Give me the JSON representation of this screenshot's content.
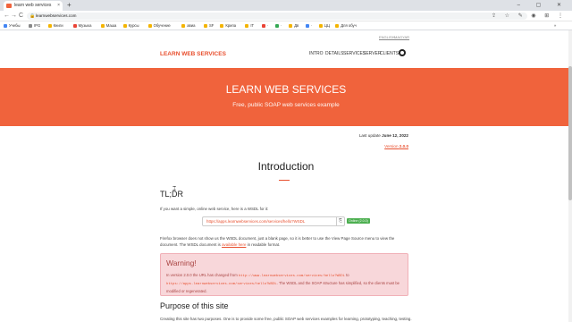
{
  "browser": {
    "tab_title": "learn web services",
    "tab_close": "×",
    "new_tab": "+",
    "window_controls": "– ▢ ✕",
    "url": "learnwebservices.com",
    "nav_back": "←",
    "nav_forward": "→",
    "nav_reload": "C",
    "lock_icon": "🔒",
    "toolbar_icons": "⇪ ☆ ✎ ◉ ⊞ ⋮",
    "bookmarks": [
      {
        "label": "Учебы",
        "color": "#4285f4"
      },
      {
        "label": "IPG",
        "color": "#888888"
      },
      {
        "label": "Книги",
        "color": "#f4b400"
      },
      {
        "label": "Музыка",
        "color": "#ea4335"
      },
      {
        "label": "Маша",
        "color": "#f4b400"
      },
      {
        "label": "Курсы",
        "color": "#f4b400"
      },
      {
        "label": "Обучение",
        "color": "#f4b400"
      },
      {
        "label": "авиа",
        "color": "#f4b400"
      },
      {
        "label": "SF",
        "color": "#f4b400"
      },
      {
        "label": "Крипа",
        "color": "#f4b400"
      },
      {
        "label": "IT",
        "color": "#f4b400"
      },
      {
        "label": "·",
        "color": "#ea4335"
      },
      {
        "label": "·",
        "color": "#34a853"
      },
      {
        "label": "Дв",
        "color": "#f4b400"
      },
      {
        "label": "·",
        "color": "#4285f4"
      },
      {
        "label": "ЦЦ",
        "color": "#f4b400"
      },
      {
        "label": "Для обуч",
        "color": "#f4b400"
      }
    ],
    "bookmarks_more": "»"
  },
  "page": {
    "lang_english": "ENGLISH",
    "lang_magyar": "MAGYAR",
    "brand": "LEARN WEB SERVICES",
    "nav": [
      "INTRO",
      "DETAILS",
      "SERVICES",
      "SERVER",
      "CLIENTS"
    ],
    "hero_title": "LEARN WEB SERVICES",
    "hero_subtitle": "Free, public SOAP web services example",
    "last_update_label": "Last update",
    "last_update_date": "June 12, 2022",
    "version_label": "Version",
    "version_value": "2.0.0",
    "intro_heading": "Introduction",
    "tldr_heading": "TL;DR",
    "tldr_text": "If you want a simple, online web service, here is a WSDL for it:",
    "wsdl_url": "https://apps.learnwebservices.com/services/hello?WSDL",
    "copy_icon": "⎘",
    "online_badge": "Online (2.0.0)",
    "firefox_text_1": "Firefox browser does not show us the WSDL document, just a blank page, so it is better to use the View Page Source menu to view the document. The WSDL document is ",
    "firefox_link": "available here",
    "firefox_text_2": " in readable format.",
    "warning_title": "Warning!",
    "warning_text_1": "In version 2.0.0 the URL has changed from ",
    "warning_old_url": "http://www.learnwebservices.com/services/hello?WSDL",
    "warning_text_2": " to ",
    "warning_new_url": "https://apps.learnwebservices.com/services/hello?WSDL",
    "warning_text_3": ". The WSDL and the SOAP structure has simplified, so the clients must be modified or regenerated.",
    "purpose_heading": "Purpose of this site",
    "purpose_text": "Creating this site has two purposes. One is to provide some free, public SOAP web services examples for learning, prototyping, teaching, testing."
  }
}
